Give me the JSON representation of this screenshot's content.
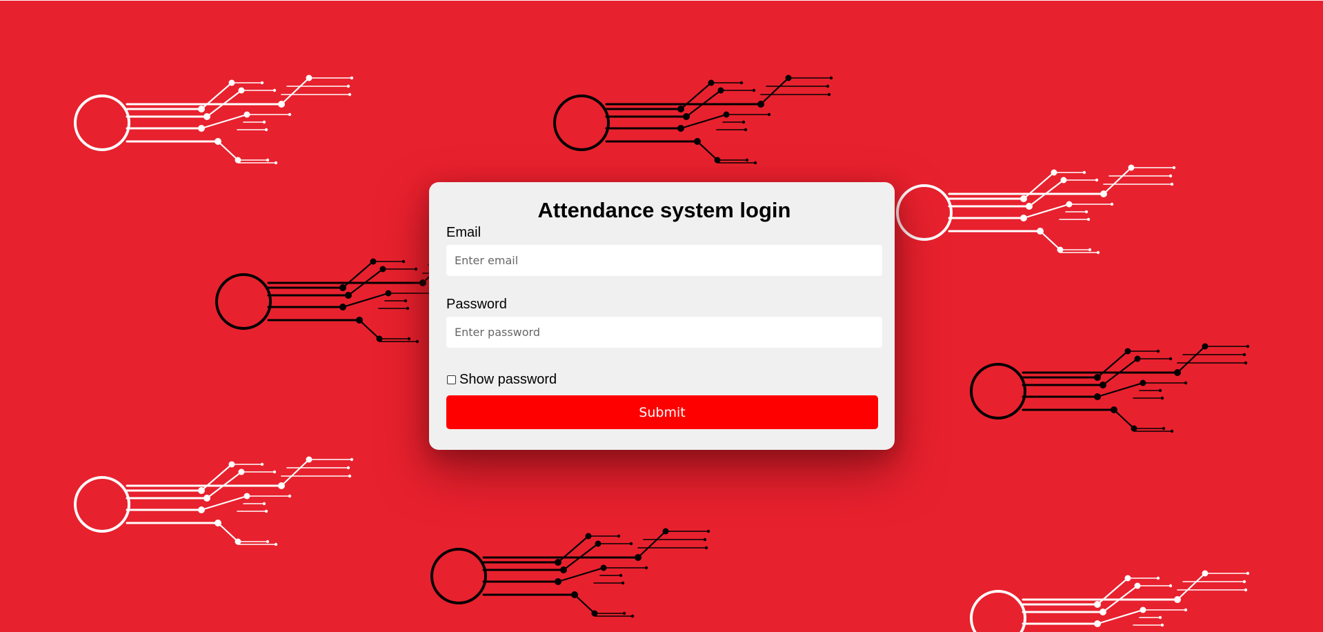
{
  "colors": {
    "background": "#e8212e",
    "accent": "#ff0000",
    "card": "#f0f0f0",
    "decoration_light": "#ffffff",
    "decoration_dark": "#000000"
  },
  "decoration": {
    "icon": "circuit-comet-icon"
  },
  "login": {
    "title": "Attendance system login",
    "email_label": "Email",
    "email_placeholder": "Enter email",
    "email_value": "",
    "password_label": "Password",
    "password_placeholder": "Enter password",
    "password_value": "",
    "show_password_label": "Show password",
    "show_password_checked": false,
    "submit_label": "Submit"
  }
}
